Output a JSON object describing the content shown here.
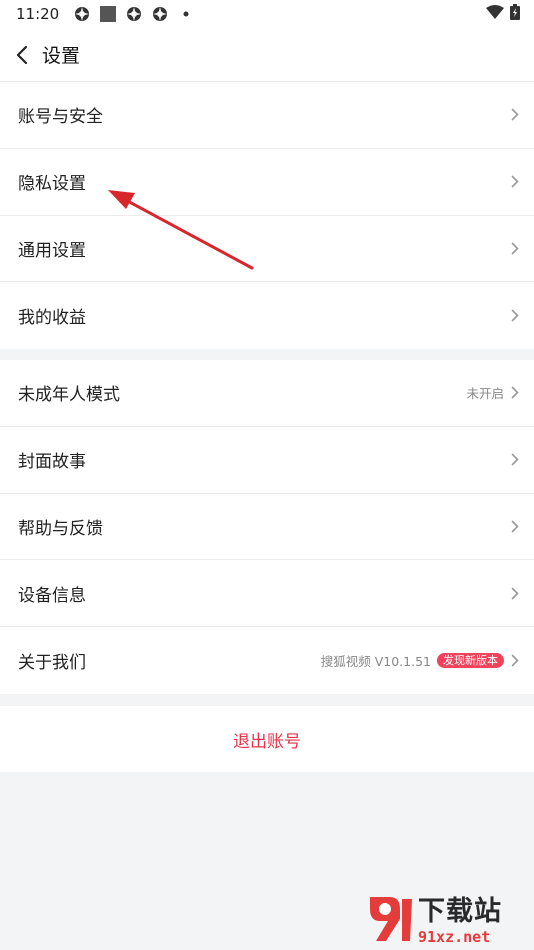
{
  "status_bar": {
    "time": "11:20",
    "left_icons": [
      "settings-gear-icon",
      "square-icon",
      "settings-gear-icon",
      "settings-gear-icon",
      "dot-icon"
    ],
    "right_icons": [
      "wifi-icon",
      "battery-icon"
    ]
  },
  "header": {
    "title": "设置"
  },
  "group1": [
    {
      "label": "账号与安全"
    },
    {
      "label": "隐私设置"
    },
    {
      "label": "通用设置"
    },
    {
      "label": "我的收益"
    }
  ],
  "group2": [
    {
      "label": "未成年人模式",
      "value": "未开启"
    },
    {
      "label": "封面故事"
    },
    {
      "label": "帮助与反馈"
    },
    {
      "label": "设备信息"
    },
    {
      "label": "关于我们",
      "value": "搜狐视频 V10.1.51",
      "badge": "发现新版本"
    }
  ],
  "logout": {
    "label": "退出账号"
  },
  "watermark": {
    "title": "下载站",
    "url": "91xz.net"
  },
  "colors": {
    "accent_red": "#e8344a",
    "badge_red": "#f0425b",
    "annotation_arrow": "#d7262c",
    "background": "#f3f4f6"
  }
}
